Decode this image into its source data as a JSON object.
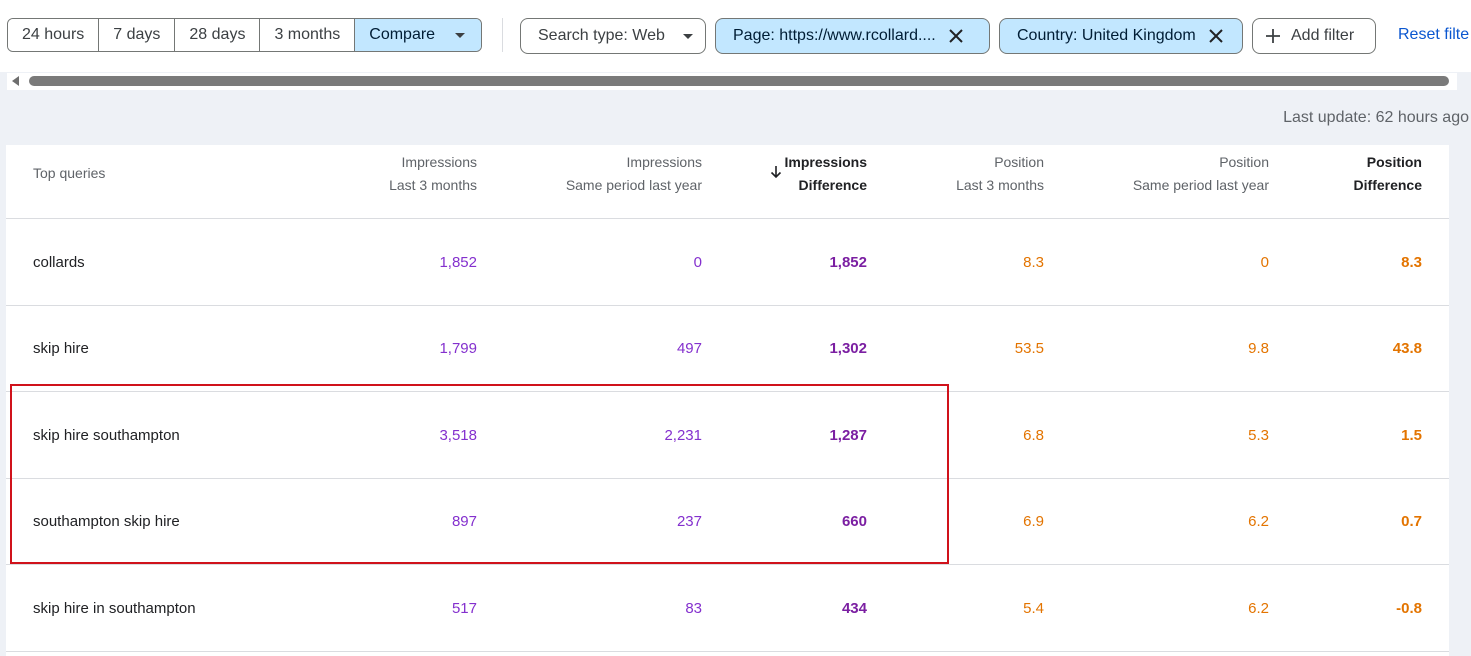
{
  "toolbar": {
    "date_ranges": [
      {
        "label": "24 hours",
        "active": false
      },
      {
        "label": "7 days",
        "active": false
      },
      {
        "label": "28 days",
        "active": false
      },
      {
        "label": "3 months",
        "active": false
      },
      {
        "label": "Compare",
        "active": true
      }
    ],
    "search_type_label": "Search type: Web",
    "page_filter_label": "Page: https://www.rcollard....",
    "country_filter_label": "Country: United Kingdom",
    "add_filter_label": "Add filter",
    "reset_label": "Reset filte"
  },
  "last_update": "Last update: 62 hours ago",
  "table": {
    "headers": {
      "query": "Top queries",
      "imp_cur_1": "Impressions",
      "imp_cur_2": "Last 3 months",
      "imp_prev_1": "Impressions",
      "imp_prev_2": "Same period last year",
      "imp_diff_1": "Impressions",
      "imp_diff_2": "Difference",
      "pos_cur_1": "Position",
      "pos_cur_2": "Last 3 months",
      "pos_prev_1": "Position",
      "pos_prev_2": "Same period last year",
      "pos_diff_1": "Position",
      "pos_diff_2": "Difference"
    },
    "rows": [
      {
        "query": "collards",
        "imp_cur": "1,852",
        "imp_prev": "0",
        "imp_diff": "1,852",
        "pos_cur": "8.3",
        "pos_prev": "0",
        "pos_diff": "8.3"
      },
      {
        "query": "skip hire",
        "imp_cur": "1,799",
        "imp_prev": "497",
        "imp_diff": "1,302",
        "pos_cur": "53.5",
        "pos_prev": "9.8",
        "pos_diff": "43.8"
      },
      {
        "query": "skip hire southampton",
        "imp_cur": "3,518",
        "imp_prev": "2,231",
        "imp_diff": "1,287",
        "pos_cur": "6.8",
        "pos_prev": "5.3",
        "pos_diff": "1.5"
      },
      {
        "query": "southampton skip hire",
        "imp_cur": "897",
        "imp_prev": "237",
        "imp_diff": "660",
        "pos_cur": "6.9",
        "pos_prev": "6.2",
        "pos_diff": "0.7"
      },
      {
        "query": "skip hire in southampton",
        "imp_cur": "517",
        "imp_prev": "83",
        "imp_diff": "434",
        "pos_cur": "5.4",
        "pos_prev": "6.2",
        "pos_diff": "-0.8"
      }
    ]
  },
  "colors": {
    "impressions": "#8430ce",
    "position": "#e37400",
    "highlight_border": "#d0121b",
    "active_chip": "#c2e7ff"
  }
}
